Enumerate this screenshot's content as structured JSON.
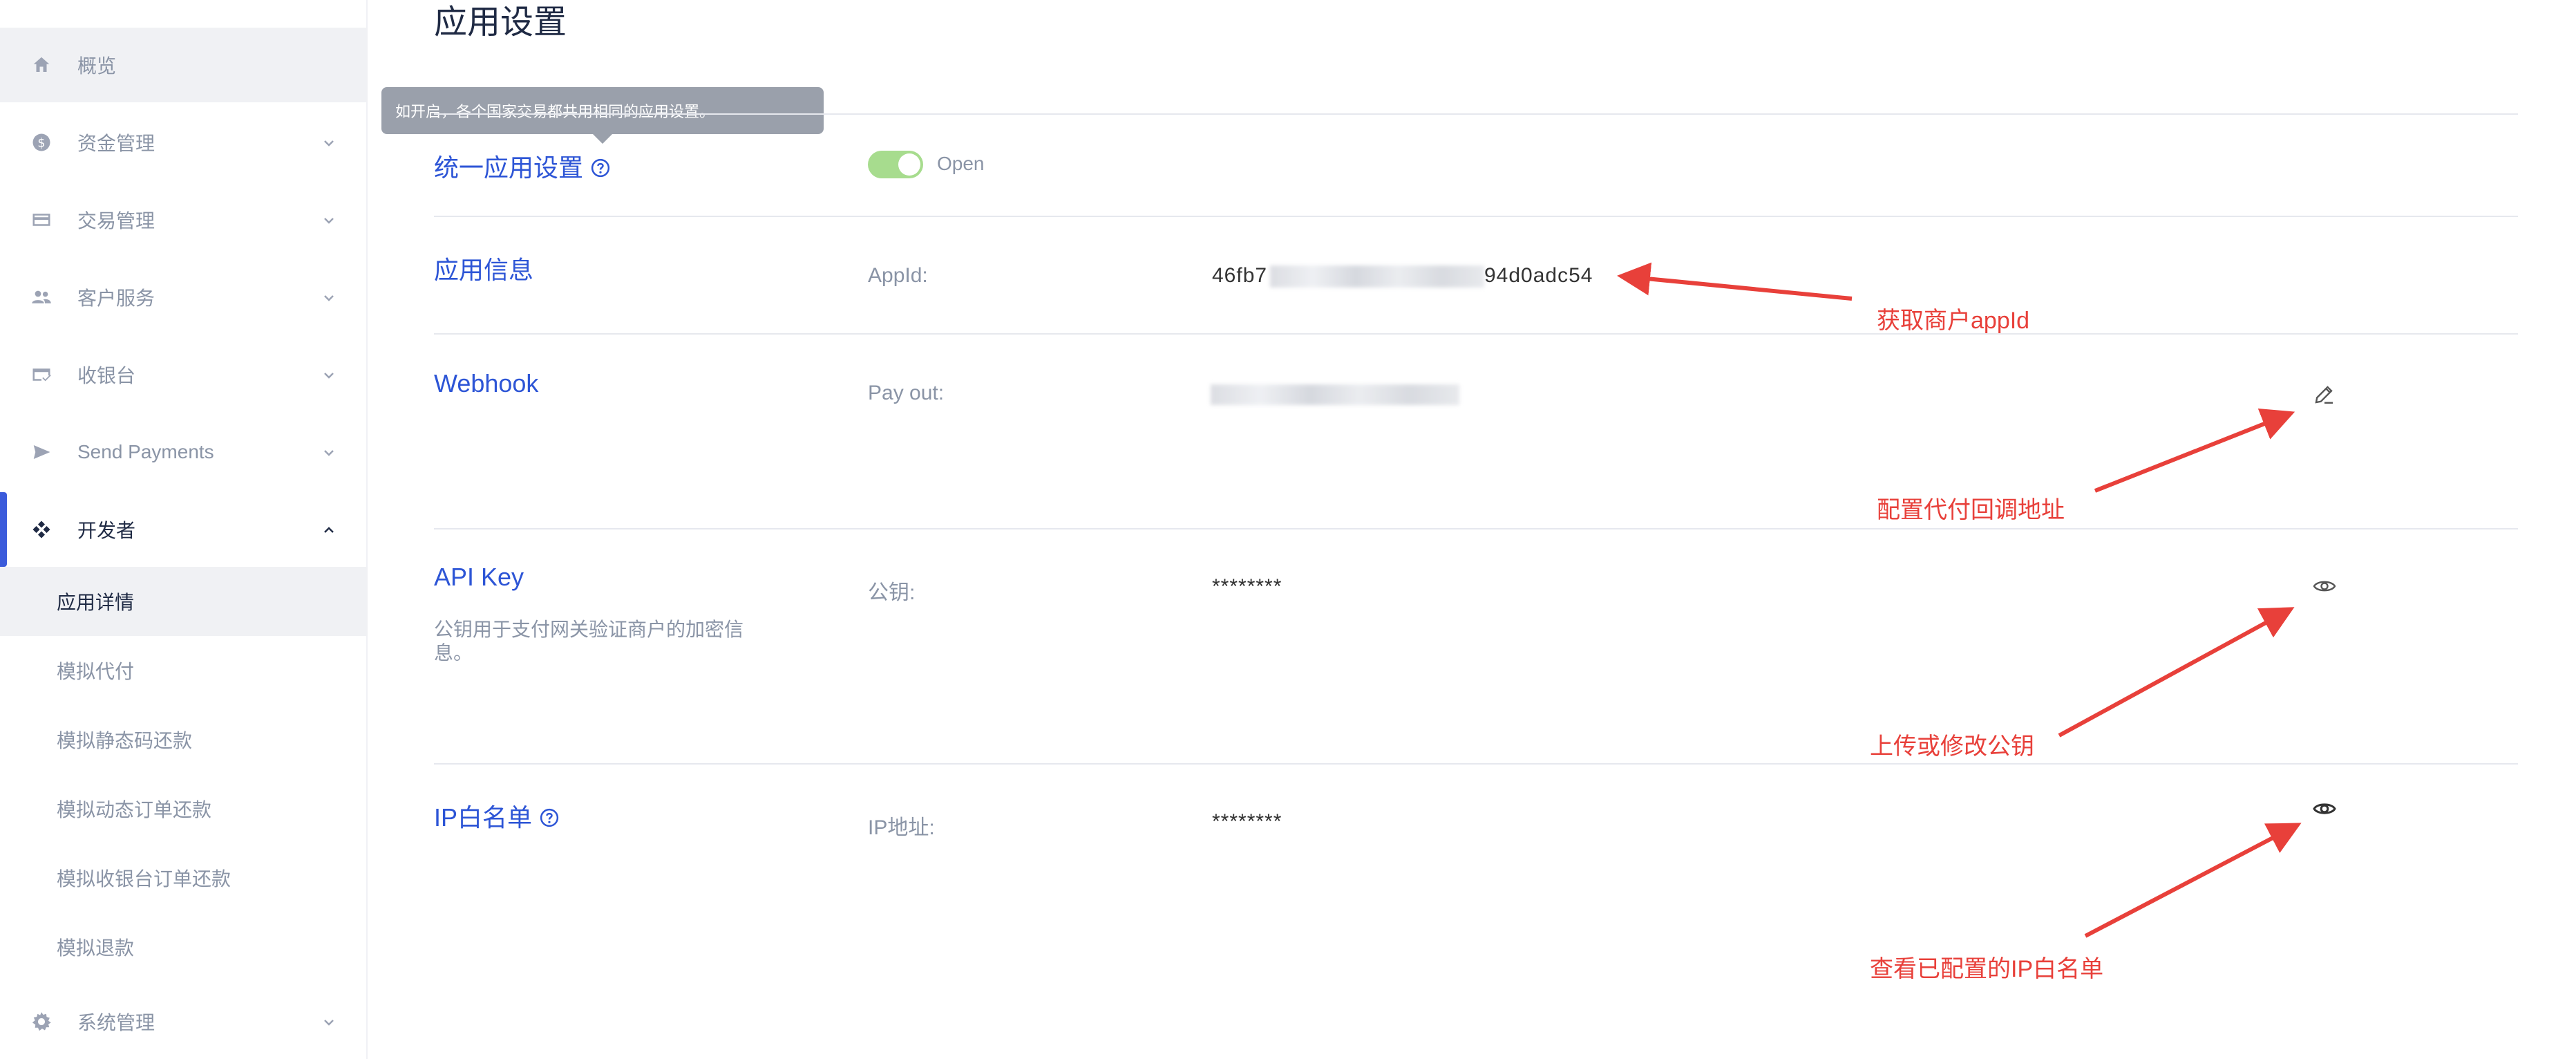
{
  "sidebar": {
    "items": [
      {
        "label": "概览",
        "icon": "home-icon"
      },
      {
        "label": "资金管理",
        "icon": "dollar-icon"
      },
      {
        "label": "交易管理",
        "icon": "card-icon"
      },
      {
        "label": "客户服务",
        "icon": "users-icon"
      },
      {
        "label": "收银台",
        "icon": "cashier-icon"
      },
      {
        "label": "Send Payments",
        "icon": "send-icon"
      },
      {
        "label": "开发者",
        "icon": "developer-icon"
      }
    ],
    "sub_items": [
      {
        "label": "应用详情"
      },
      {
        "label": "模拟代付"
      },
      {
        "label": "模拟静态码还款"
      },
      {
        "label": "模拟动态订单还款"
      },
      {
        "label": "模拟收银台订单还款"
      },
      {
        "label": "模拟退款"
      }
    ],
    "bottom_item": {
      "label": "系统管理",
      "icon": "settings-icon"
    }
  },
  "page": {
    "title": "应用设置",
    "tooltip": "如开启，各个国家交易都共用相同的应用设置。"
  },
  "sections": {
    "unified": {
      "title": "统一应用设置",
      "toggle_text": "Open"
    },
    "app_info": {
      "title": "应用信息",
      "label": "AppId:",
      "value_prefix": "46fb7",
      "value_suffix": "94d0adc54"
    },
    "webhook": {
      "title": "Webhook",
      "label": "Pay out:"
    },
    "api_key": {
      "title": "API Key",
      "desc": "公钥用于支付网关验证商户的加密信息。",
      "label": "公钥:",
      "value": "********"
    },
    "ip_whitelist": {
      "title": "IP白名单",
      "label": "IP地址:",
      "value": "********"
    }
  },
  "annotations": {
    "appid": "获取商户appId",
    "webhook": "配置代付回调地址",
    "pubkey": "上传或修改公钥",
    "ip": "查看已配置的IP白名单"
  },
  "colors": {
    "accent": "#2d55d6",
    "toggle_on": "#a7dc8e",
    "annotation": "#e8403a"
  }
}
